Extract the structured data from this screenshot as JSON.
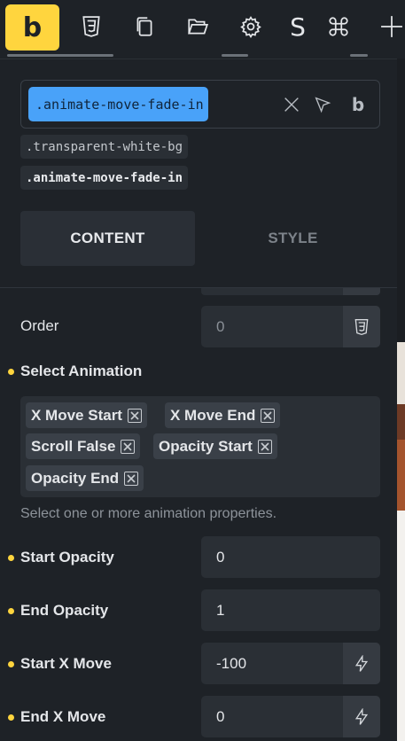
{
  "toolbar": {
    "logo_letter": "b",
    "icons": [
      "css3-icon",
      "copy-pages-icon",
      "folder-open-icon",
      "gear-icon",
      "s-icon",
      "command-icon",
      "plus-icon"
    ],
    "s_label": "S"
  },
  "class_selector": {
    "active_class": ".animate-move-fade-in",
    "action_icons": [
      "close-icon",
      "cursor-select-icon",
      "bricks-b-icon"
    ],
    "b_label": "b",
    "classes": [
      ".transparent-white-bg",
      ".animate-move-fade-in"
    ]
  },
  "tabs": {
    "content_label": "CONTENT",
    "style_label": "STYLE",
    "active": "CONTENT"
  },
  "fields": {
    "order": {
      "label": "Order",
      "placeholder": "0"
    },
    "select_animation": {
      "label": "Select Animation",
      "chips": [
        "X Move Start",
        "X Move End",
        "Scroll False",
        "Opacity Start",
        "Opacity End"
      ],
      "helper": "Select one or more animation properties."
    },
    "start_opacity": {
      "label": "Start Opacity",
      "value": "0"
    },
    "end_opacity": {
      "label": "End Opacity",
      "value": "1"
    },
    "start_x_move": {
      "label": "Start X Move",
      "value": "-100"
    },
    "end_x_move": {
      "label": "End X Move",
      "value": "0"
    }
  },
  "colors": {
    "accent": "#ffd53e",
    "active_class_bg": "#49a2f9",
    "panel_bg": "#1e2227",
    "field_bg": "#2a2f35"
  }
}
